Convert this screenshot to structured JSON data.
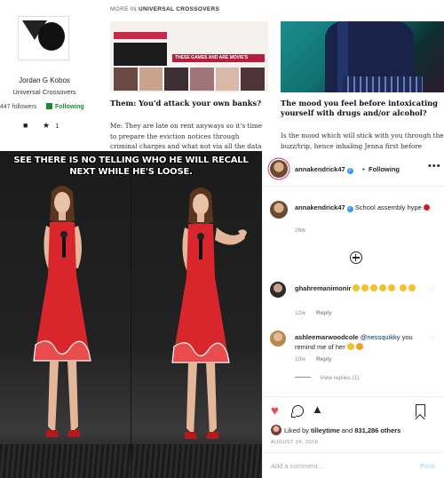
{
  "blog": {
    "author_name": "Jordan G Kobos",
    "author_group": "Universal Crossovers",
    "followers": "447 followers",
    "follow_label": "Following",
    "clap_count": "1",
    "section_prefix": "MORE IN ",
    "section_name": "UNIVERSAL CROSSOVERS",
    "card1_banner": "THESE GAMES AND ARE MOVIE'S GAMES?",
    "card1_title": "Them: You'd attack your own banks?",
    "card1_excerpt": "Me: They are late on rent anyways so it's time to prepare the eviction notices through criminal charges and what not via all the data gathered",
    "card2_title": "The mood you feel before intoxicating yourself with drugs and/or alcohol?",
    "card2_excerpt": "Is the mood which will stick with you through the buzz/trip, hence inhaling Jenna first before"
  },
  "meme": {
    "caption": "SEE THERE IS NO TELLING WHO HE WILL RECALL NEXT WHILE HE'S LOOSE."
  },
  "instagram": {
    "username": "annakendrick47",
    "follow_state": "Following",
    "caption_user": "annakendrick47",
    "caption_text": "School assembly hype",
    "caption_age": "26w",
    "comments": [
      {
        "user": "ghahremanimonir",
        "text": "",
        "age": "12w",
        "reply": "Reply"
      },
      {
        "user": "ashleemarwoodcole",
        "mention": "@nessquikky",
        "text": "you remind me of her",
        "age": "10w",
        "reply": "Reply",
        "view_replies": "View replies (1)"
      }
    ],
    "liked_by_prefix": "Liked by ",
    "liked_by_user": "tilleytime",
    "liked_by_mid": " and ",
    "liked_by_count": "831,286 others",
    "date": "AUGUST 24, 2018",
    "add_comment_placeholder": "Add a comment…",
    "post_label": "Post"
  },
  "colors": {
    "instagram_blue": "#3897f0",
    "like_red": "#ed4956",
    "dress_red": "#d8262c",
    "follow_green": "#1a8a3a"
  },
  "icons": [
    "comment-icon",
    "star-icon",
    "verified-icon",
    "more-options-icon",
    "add-circle-icon",
    "heart-icon",
    "comment-bubble-icon",
    "share-icon",
    "bookmark-icon"
  ]
}
